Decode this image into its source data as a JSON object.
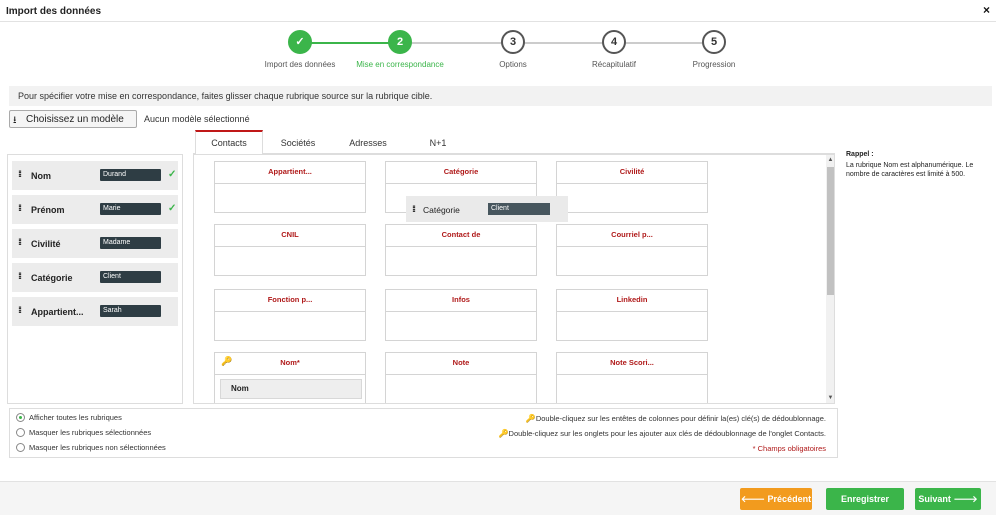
{
  "window": {
    "title": "Import des données",
    "close_icon": "×"
  },
  "stepper": {
    "steps": [
      {
        "num": "✓",
        "label": "Import des données",
        "state": "done"
      },
      {
        "num": "2",
        "label": "Mise en correspondance",
        "state": "active"
      },
      {
        "num": "3",
        "label": "Options",
        "state": "todo"
      },
      {
        "num": "4",
        "label": "Récapitulatif",
        "state": "todo"
      },
      {
        "num": "5",
        "label": "Progression",
        "state": "todo"
      }
    ]
  },
  "info": "Pour spécifier votre mise en correspondance, faites glisser chaque rubrique source sur la rubrique cible.",
  "model": {
    "button_label": "Choisissez un modèle",
    "download_icon": "⭳",
    "status": "Aucun modèle sélectionné"
  },
  "tabs": [
    "Contacts",
    "Sociétés",
    "Adresses",
    "N+1"
  ],
  "source_fields": [
    {
      "name": "Nom",
      "value": "Durand",
      "mapped": true
    },
    {
      "name": "Prénom",
      "value": "Marie",
      "mapped": true
    },
    {
      "name": "Civilité",
      "value": "Madame",
      "mapped": false
    },
    {
      "name": "Catégorie",
      "value": "Client",
      "mapped": false
    },
    {
      "name": "Appartient...",
      "value": "Sarah",
      "mapped": false
    }
  ],
  "target_fields": [
    {
      "label": "Appartient...",
      "key": false,
      "mapped": ""
    },
    {
      "label": "Catégorie",
      "key": false,
      "mapped": ""
    },
    {
      "label": "Civilité",
      "key": false,
      "mapped": ""
    },
    {
      "label": "CNIL",
      "key": false,
      "mapped": ""
    },
    {
      "label": "Contact de",
      "key": false,
      "mapped": ""
    },
    {
      "label": "Courriel p...",
      "key": false,
      "mapped": ""
    },
    {
      "label": "Fonction p...",
      "key": false,
      "mapped": ""
    },
    {
      "label": "Infos",
      "key": false,
      "mapped": ""
    },
    {
      "label": "Linkedin",
      "key": false,
      "mapped": ""
    },
    {
      "label": "Nom*",
      "key": true,
      "mapped": "Nom"
    },
    {
      "label": "Note",
      "key": false,
      "mapped": ""
    },
    {
      "label": "Note Scori...",
      "key": false,
      "mapped": ""
    }
  ],
  "dragging": {
    "name": "Catégorie",
    "value": "Client"
  },
  "rappel": {
    "title": "Rappel :",
    "text": "La rubrique Nom est alphanumérique. Le nombre de caractères est limité à 500."
  },
  "display_options": [
    {
      "label": "Afficher toutes les rubriques",
      "selected": true
    },
    {
      "label": "Masquer les rubriques sélectionnées",
      "selected": false
    },
    {
      "label": "Masquer les rubriques non sélectionnées",
      "selected": false
    }
  ],
  "hints": {
    "columns": "Double-cliquez sur les entêtes de colonnes pour définir la(es) clé(s) de dédoublonnage.",
    "tabs": "Double-cliquez sur les onglets pour les ajouter aux clés de dédoublonnage de l'onglet Contacts.",
    "required": "* Champs obligatoires"
  },
  "footer": {
    "prev": "Précédent",
    "save": "Enregistrer",
    "next": "Suivant"
  },
  "colors": {
    "accent_green": "#3bb54a",
    "accent_orange": "#f29b1e",
    "field_red": "#b01a1a",
    "tab_red": "#c01818"
  }
}
